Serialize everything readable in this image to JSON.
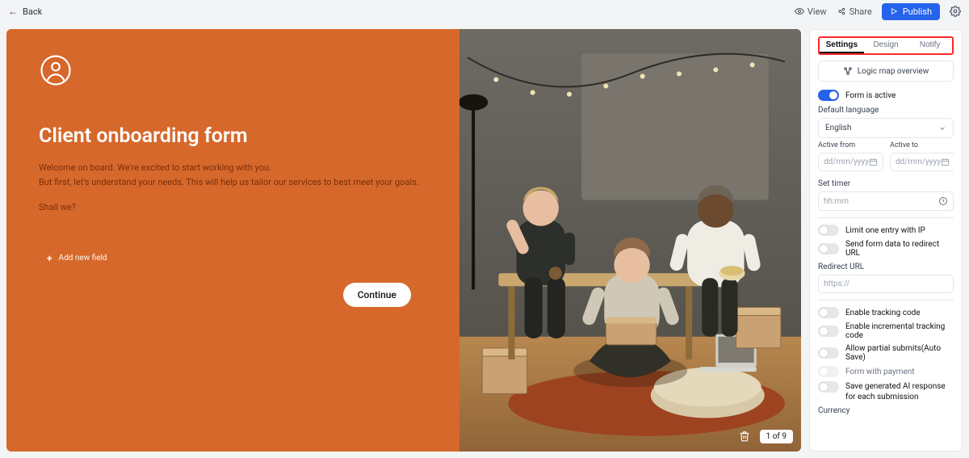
{
  "topbar": {
    "back": "Back",
    "view": "View",
    "share": "Share",
    "publish": "Publish"
  },
  "form": {
    "title": "Client onboarding form",
    "line1": "Welcome on board. We're excited to start working with you.",
    "line2": "But first, let's understand your needs. This will help us tailor our services to best meet your goals.",
    "line3": "Shall we?",
    "addfield": "Add new field",
    "continue": "Continue"
  },
  "pager": {
    "label": "1 of 9"
  },
  "panel": {
    "tabs": {
      "settings": "Settings",
      "design": "Design",
      "notify": "Notify"
    },
    "logicmap": "Logic map overview",
    "active_label": "Form is active",
    "default_language_label": "Default language",
    "default_language_value": "English",
    "active_from_label": "Active from",
    "active_to_label": "Active to",
    "date_placeholder": "dd/mm/yyyy",
    "set_timer_label": "Set timer",
    "timer_placeholder": "hh:mm",
    "limit_ip": "Limit one entry with IP",
    "send_redirect": "Send form data to redirect URL",
    "redirect_url_label": "Redirect URL",
    "redirect_placeholder": "https://",
    "tracking": "Enable tracking code",
    "incremental_tracking": "Enable incremental tracking code",
    "partial_submits": "Allow partial submits(Auto Save)",
    "form_payment": "Form with payment",
    "save_ai": "Save generated AI response for each submission",
    "currency_label": "Currency"
  }
}
